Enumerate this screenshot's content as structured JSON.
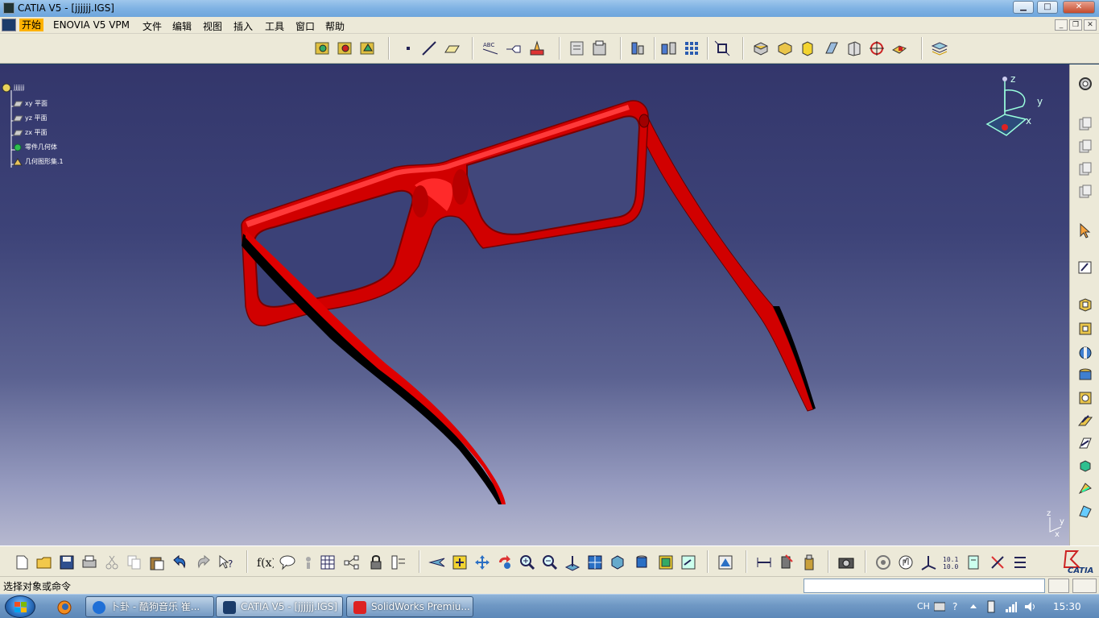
{
  "window": {
    "title": "CATIA V5 - [jjjjjj.IGS]",
    "controls": {
      "minimize": "▁",
      "maximize": "□",
      "close": "✕"
    }
  },
  "menu": {
    "items": [
      "开始",
      "ENOVIA V5 VPM",
      "文件",
      "编辑",
      "视图",
      "插入",
      "工具",
      "窗口",
      "帮助"
    ],
    "active_index": 0,
    "mdi_controls": {
      "minimize": "_",
      "restore": "❐",
      "close": "✕"
    }
  },
  "spec_tree": {
    "root": "jjjjjj",
    "nodes": [
      "xy 平面",
      "yz 平面",
      "zx 平面",
      "零件几何体",
      "几何图形集.1"
    ]
  },
  "compass": {
    "x": "x",
    "y": "y",
    "z": "z"
  },
  "axis_indicator": {
    "x": "x",
    "y": "y",
    "z": "z"
  },
  "brand": {
    "logo_text": "CATIA"
  },
  "status": {
    "prompt": "选择对象或命令",
    "command_input": ""
  },
  "colors": {
    "accent_menu": "#ffb200",
    "model_red": "#e00000",
    "viewport_top": "#33366b",
    "viewport_bottom": "#b6b8cf"
  },
  "toolbar_icons": {
    "top": [
      "sketcher-icon",
      "save-doc-icon",
      "open-doc-icon",
      "point-icon",
      "line-icon",
      "plane-icon",
      "text-abc-icon",
      "annotation-icon",
      "stamp-icon",
      "drawing-icon",
      "sheet-icon",
      "catalog-icon",
      "grid-icon",
      "pattern-icon",
      "snap-icon",
      "pad-icon",
      "pocket-icon",
      "shaft-icon",
      "groove-icon",
      "hole-icon",
      "target-icon",
      "measure-icon",
      "layers-icon"
    ],
    "bottom": [
      "new-icon",
      "open-icon",
      "save-icon",
      "print-icon",
      "cut-icon",
      "copy-icon",
      "paste-icon",
      "undo-icon",
      "redo-icon",
      "whats-this-icon",
      "formula-icon",
      "comment-icon",
      "knowledge-icon",
      "table-icon",
      "graph-icon",
      "lock-icon",
      "parameters-icon",
      "fly-icon",
      "fit-all-icon",
      "pan-icon",
      "rotate-icon",
      "zoom-in-icon",
      "zoom-out-icon",
      "normal-view-icon",
      "multi-view-icon",
      "iso-view-icon",
      "shading-icon",
      "hide-show-icon",
      "swap-icon",
      "render-icon",
      "measure-icon",
      "inertia-icon",
      "material-icon",
      "camera-icon",
      "rotate-view-icon",
      "hand-icon",
      "axis-icon",
      "dimension-icon",
      "compass-icon",
      "constraint-icon",
      "list-icon"
    ],
    "right": [
      "settings-icon",
      "copy-doc-icon",
      "copy-doc-icon",
      "copy-doc-icon",
      "copy-doc-icon",
      "select-icon",
      "sketch-icon",
      "pad-icon",
      "pocket-icon",
      "shaft-icon",
      "groove-icon",
      "hole-icon",
      "rib-icon",
      "slot-icon",
      "solid-icon",
      "chamfer-icon",
      "draft-icon"
    ]
  },
  "taskbar": {
    "tasks": [
      "卜卦 - 酷狗音乐 崔...",
      "CATIA V5 - [jjjjjj.IGS]",
      "SolidWorks Premiu..."
    ],
    "tray": {
      "lang": "CH",
      "time": "15:30"
    }
  }
}
